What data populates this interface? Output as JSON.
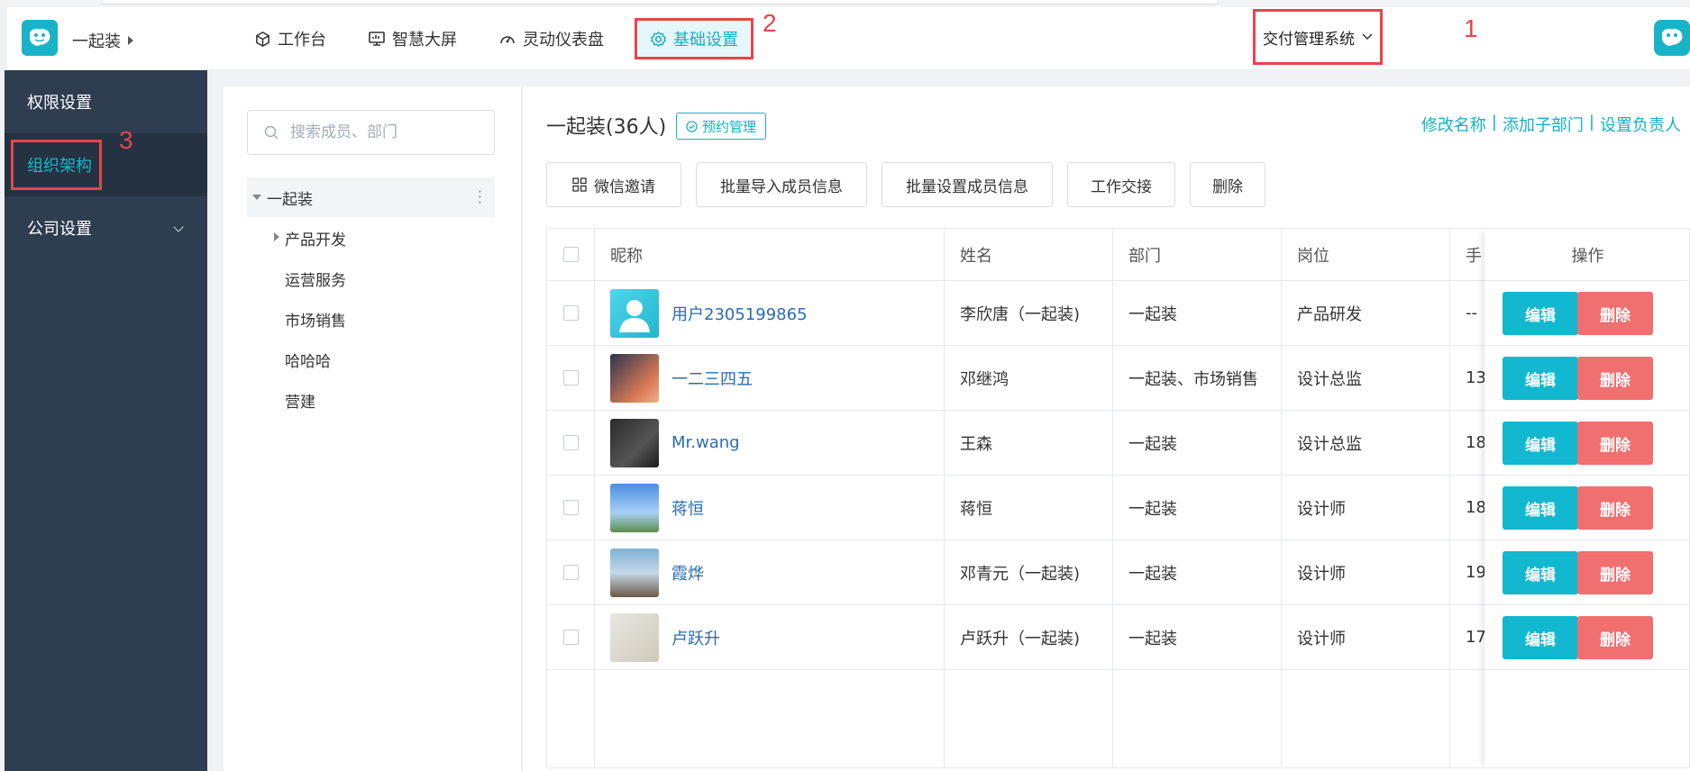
{
  "header": {
    "company": "一起装",
    "nav": [
      {
        "label": "工作台",
        "icon": "cube-icon"
      },
      {
        "label": "智慧大屏",
        "icon": "monitor-icon"
      },
      {
        "label": "灵动仪表盘",
        "icon": "gauge-icon"
      },
      {
        "label": "基础设置",
        "icon": "gear-icon",
        "active": true
      }
    ],
    "system_switcher": "交付管理系统"
  },
  "annotations": [
    "1",
    "2",
    "3"
  ],
  "sidebar": {
    "items": [
      {
        "label": "权限设置"
      },
      {
        "label": "组织架构",
        "active": true
      },
      {
        "label": "公司设置",
        "has_submenu": true
      }
    ]
  },
  "tree": {
    "search_placeholder": "搜索成员、部门",
    "root": "一起装",
    "children": [
      "产品开发",
      "运营服务",
      "市场销售",
      "哈哈哈",
      "营建"
    ]
  },
  "main": {
    "title": "一起装(36人)",
    "tag": "预约管理",
    "links": [
      "修改名称",
      "添加子部门",
      "设置负责人"
    ],
    "link_sep": "|",
    "buttons": [
      "微信邀请",
      "批量导入成员信息",
      "批量设置成员信息",
      "工作交接",
      "删除"
    ]
  },
  "table": {
    "headers": [
      "昵称",
      "姓名",
      "部门",
      "岗位",
      "手",
      "操作"
    ],
    "rows": [
      {
        "nickname": "用户2305199865",
        "name": "李欣唐（一起装)",
        "dept": "一起装",
        "position": "产品研发",
        "phone": "--"
      },
      {
        "nickname": "一二三四五",
        "name": "邓继鸿",
        "dept": "一起装、市场销售",
        "position": "设计总监",
        "phone": "13"
      },
      {
        "nickname": "Mr.wang",
        "name": "王森",
        "dept": "一起装",
        "position": "设计总监",
        "phone": "18"
      },
      {
        "nickname": "蒋恒",
        "name": "蒋恒",
        "dept": "一起装",
        "position": "设计师",
        "phone": "18"
      },
      {
        "nickname": "霞烨",
        "name": "邓青元（一起装)",
        "dept": "一起装",
        "position": "设计师",
        "phone": "19"
      },
      {
        "nickname": "卢跃升",
        "name": "卢跃升（一起装)",
        "dept": "一起装",
        "position": "设计师",
        "phone": "17"
      }
    ],
    "edit_label": "编辑",
    "delete_label": "删除"
  },
  "colors": {
    "accent": "#13b1c6",
    "sidebar_bg": "#2e3d4f",
    "annotation_red": "#e8434b",
    "edit_btn": "#12b8cf",
    "delete_btn": "#f06f6f"
  }
}
